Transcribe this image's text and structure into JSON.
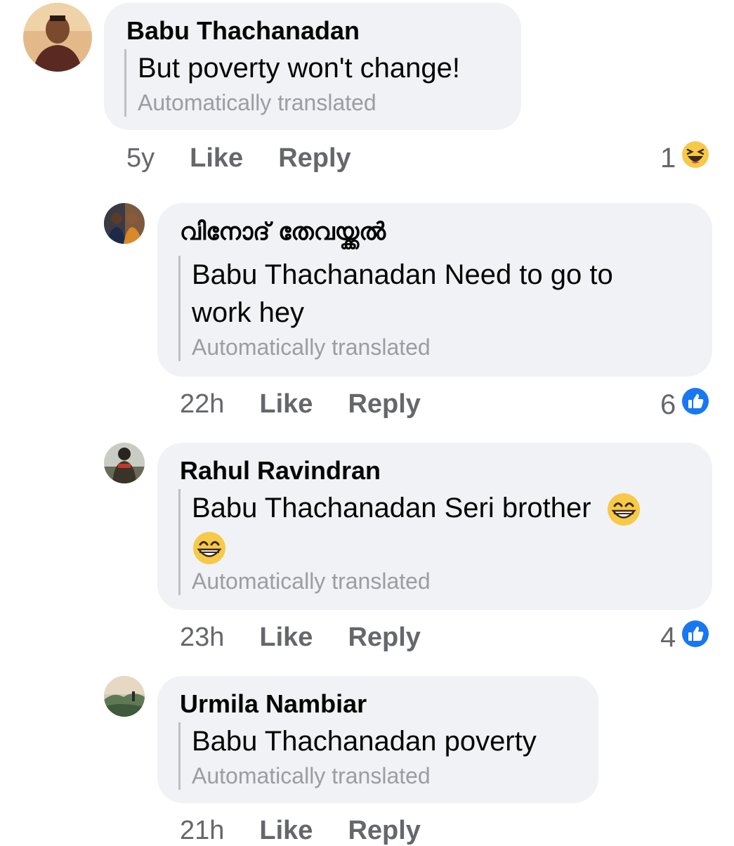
{
  "comments": [
    {
      "author": "Babu Thachanadan",
      "text": "But poverty won't change!",
      "translated_label": "Automatically translated",
      "time": "5y",
      "like_label": "Like",
      "reply_label": "Reply",
      "reaction_count": "1",
      "reaction_icon": "haha-icon"
    },
    {
      "author": "വിനോദ് തേവയ്ക്കൽ",
      "text_line1": "Babu Thachanadan Need to go to",
      "text_line2": "work hey",
      "translated_label": "Automatically translated",
      "time": "22h",
      "like_label": "Like",
      "reply_label": "Reply",
      "reaction_count": "6",
      "reaction_icon": "like-icon"
    },
    {
      "author": "Rahul Ravindran",
      "text": "Babu Thachanadan Seri brother",
      "translated_label": "Automatically translated",
      "time": "23h",
      "like_label": "Like",
      "reply_label": "Reply",
      "reaction_count": "4",
      "reaction_icon": "like-icon"
    },
    {
      "author": "Urmila Nambiar",
      "text": "Babu Thachanadan poverty",
      "translated_label": "Automatically translated",
      "time": "21h",
      "like_label": "Like",
      "reply_label": "Reply"
    }
  ],
  "colors": {
    "bubble": "#f0f2f5",
    "meta_text": "#65676b",
    "like_blue": "#1877f2",
    "haha_yellow": "#f7c948"
  }
}
